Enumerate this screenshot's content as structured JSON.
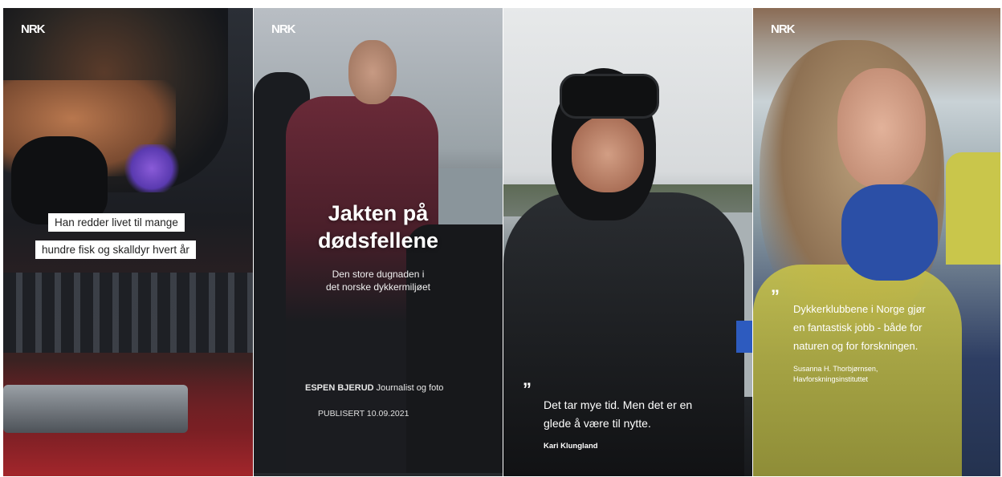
{
  "logo_text": "NRK",
  "panel1": {
    "caption_line1": "Han redder livet til mange",
    "caption_line2": "hundre fisk og skalldyr hvert år"
  },
  "panel2": {
    "title_line1": "Jakten på",
    "title_line2": "dødsfellene",
    "subtitle_line1": "Den store dugnaden i",
    "subtitle_line2": "det norske dykkermiljøet",
    "author_name": "ESPEN BJERUD",
    "author_role": "Journalist og foto",
    "published": "PUBLISERT 10.09.2021"
  },
  "panel3": {
    "quote_line1": "Det tar mye tid. Men det er en",
    "quote_line2": "glede å være til nytte.",
    "quote_source": "Kari Klungland"
  },
  "panel4": {
    "quote_line1": "Dykkerklubbene i Norge gjør",
    "quote_line2": "en fantastisk jobb - både for",
    "quote_line3": "naturen og for forskningen.",
    "source_name": "Susanna H. Thorbjørnsen,",
    "source_org": "Havforskningsinstituttet"
  },
  "colors": {
    "caption_bg": "#ffffff",
    "text_on_photo": "#ffffff",
    "scarf_blue": "#2b4fa6",
    "vest_yellow": "#c7c24a"
  },
  "icons": {
    "quote": "quote-icon"
  }
}
